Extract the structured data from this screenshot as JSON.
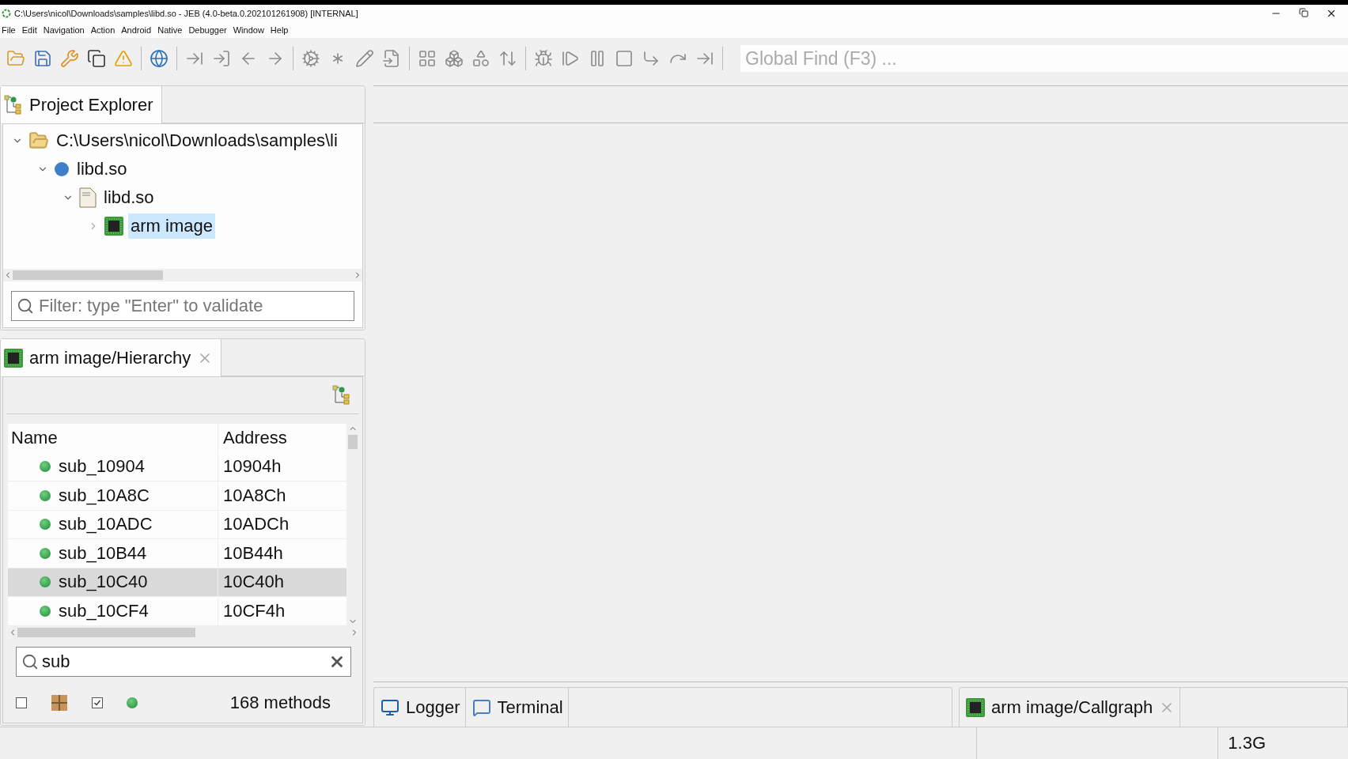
{
  "window": {
    "title": "C:\\Users\\nicol\\Downloads\\samples\\libd.so - JEB (4.0-beta.0.202101261908) [INTERNAL]"
  },
  "menu": [
    "File",
    "Edit",
    "Navigation",
    "Action",
    "Android",
    "Native",
    "Debugger",
    "Window",
    "Help"
  ],
  "global_find": {
    "placeholder": "Global Find (F3) ..."
  },
  "project_explorer": {
    "tab": "Project Explorer",
    "tree": [
      {
        "label": "C:\\Users\\nicol\\Downloads\\samples\\li",
        "kind": "folder",
        "expanded": true,
        "selected": false,
        "children": [
          {
            "label": "libd.so",
            "kind": "artifact",
            "expanded": true,
            "selected": false,
            "children": [
              {
                "label": "libd.so",
                "kind": "elf",
                "expanded": true,
                "selected": false,
                "children": [
                  {
                    "label": "arm image",
                    "kind": "chip",
                    "expanded": false,
                    "selected": true
                  }
                ]
              }
            ]
          }
        ]
      }
    ],
    "filter": {
      "placeholder": "Filter: type \"Enter\" to validate"
    }
  },
  "hierarchy": {
    "tab": "arm image/Hierarchy",
    "columns": [
      "Name",
      "Address"
    ],
    "rows": [
      {
        "name": "sub_10904",
        "address": "10904h",
        "selected": false
      },
      {
        "name": "sub_10A8C",
        "address": "10A8Ch",
        "selected": false
      },
      {
        "name": "sub_10ADC",
        "address": "10ADCh",
        "selected": false
      },
      {
        "name": "sub_10B44",
        "address": "10B44h",
        "selected": false
      },
      {
        "name": "sub_10C40",
        "address": "10C40h",
        "selected": true
      },
      {
        "name": "sub_10CF4",
        "address": "10CF4h",
        "selected": false
      }
    ],
    "search": {
      "value": "sub"
    },
    "toggles": [
      {
        "checked": false
      },
      {
        "checked": true
      }
    ],
    "count": "168 methods"
  },
  "bottom_tabs": [
    {
      "label": "Logger",
      "kind": "logger"
    },
    {
      "label": "Terminal",
      "kind": "terminal"
    }
  ],
  "editor_tabs": [
    {
      "label": "arm image/Callgraph",
      "kind": "chip"
    }
  ],
  "status_bar": {
    "memory": "1.3G"
  }
}
